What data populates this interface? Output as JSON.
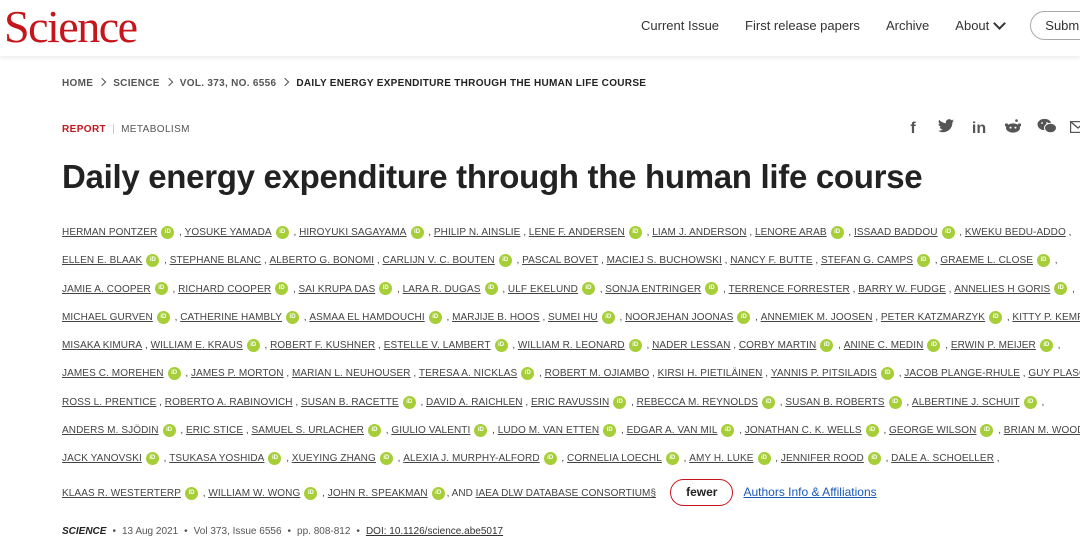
{
  "header": {
    "logo": "Science",
    "nav": [
      "Current Issue",
      "First release papers",
      "Archive",
      "About",
      "Subm"
    ]
  },
  "breadcrumb": [
    "HOME",
    "SCIENCE",
    "VOL. 373, NO. 6556",
    "DAILY ENERGY EXPENDITURE THROUGH THE HUMAN LIFE COURSE"
  ],
  "article": {
    "type": "REPORT",
    "category": "METABOLISM",
    "title": "Daily energy expenditure through the human life course",
    "orcid_label": "iD",
    "fewer_label": "fewer",
    "affiliations_label": "Authors Info & Affiliations",
    "and_text": ", AND"
  },
  "share_icons": [
    "facebook-icon",
    "twitter-icon",
    "linkedin-icon",
    "reddit-icon",
    "wechat-icon",
    "email-icon"
  ],
  "authors": [
    [
      [
        "HERMAN PONTZER",
        1
      ],
      [
        "YOSUKE YAMADA",
        1
      ],
      [
        "HIROYUKI SAGAYAMA",
        1
      ],
      [
        "PHILIP N. AINSLIE",
        0
      ],
      [
        "LENE F. ANDERSEN",
        1
      ],
      [
        "LIAM J. ANDERSON",
        0
      ],
      [
        "LENORE ARAB",
        1
      ],
      [
        "ISSAAD BADDOU",
        1
      ],
      [
        "KWEKU BEDU-ADDO",
        0
      ]
    ],
    [
      [
        "ELLEN E. BLAAK",
        1
      ],
      [
        "STEPHANE BLANC",
        0
      ],
      [
        "ALBERTO G. BONOMI",
        0
      ],
      [
        "CARLIJN V. C. BOUTEN",
        1
      ],
      [
        "PASCAL BOVET",
        0
      ],
      [
        "MACIEJ S. BUCHOWSKI",
        0
      ],
      [
        "NANCY F. BUTTE",
        0
      ],
      [
        "STEFAN G. CAMPS",
        1
      ],
      [
        "GRAEME L. CLOSE",
        1
      ]
    ],
    [
      [
        "JAMIE A. COOPER",
        1
      ],
      [
        "RICHARD COOPER",
        1
      ],
      [
        "SAI KRUPA DAS",
        1
      ],
      [
        "LARA R. DUGAS",
        1
      ],
      [
        "ULF EKELUND",
        1
      ],
      [
        "SONJA ENTRINGER",
        1
      ],
      [
        "TERRENCE FORRESTER",
        0
      ],
      [
        "BARRY W. FUDGE",
        0
      ],
      [
        "ANNELIES H GORIS",
        1
      ]
    ],
    [
      [
        "MICHAEL GURVEN",
        1
      ],
      [
        "CATHERINE HAMBLY",
        1
      ],
      [
        "ASMAA EL HAMDOUCHI",
        1
      ],
      [
        "MARJIJE B. HOOS",
        0
      ],
      [
        "SUMEI HU",
        1
      ],
      [
        "NOORJEHAN JOONAS",
        1
      ],
      [
        "ANNEMIEK M. JOOSEN",
        0
      ],
      [
        "PETER KATZMARZYK",
        1
      ],
      [
        "KITTY P. KEMPEN",
        0
      ]
    ],
    [
      [
        "MISAKA KIMURA",
        0
      ],
      [
        "WILLIAM E. KRAUS",
        1
      ],
      [
        "ROBERT F. KUSHNER",
        0
      ],
      [
        "ESTELLE V. LAMBERT",
        1
      ],
      [
        "WILLIAM R. LEONARD",
        1
      ],
      [
        "NADER LESSAN",
        0
      ],
      [
        "CORBY MARTIN",
        1
      ],
      [
        "ANINE C. MEDIN",
        1
      ],
      [
        "ERWIN P. MEIJER",
        1
      ]
    ],
    [
      [
        "JAMES C. MOREHEN",
        1
      ],
      [
        "JAMES P. MORTON",
        0
      ],
      [
        "MARIAN L. NEUHOUSER",
        0
      ],
      [
        "TERESA A. NICKLAS",
        1
      ],
      [
        "ROBERT M. OJIAMBO",
        0
      ],
      [
        "KIRSI H. PIETILÄINEN",
        0
      ],
      [
        "YANNIS P. PITSILADIS",
        1
      ],
      [
        "JACOB PLANGE-RHULE",
        0
      ],
      [
        "GUY PLASQUI",
        1
      ]
    ],
    [
      [
        "ROSS L. PRENTICE",
        0
      ],
      [
        "ROBERTO A. RABINOVICH",
        0
      ],
      [
        "SUSAN B. RACETTE",
        1
      ],
      [
        "DAVID A. RAICHLEN",
        0
      ],
      [
        "ERIC RAVUSSIN",
        1
      ],
      [
        "REBECCA M. REYNOLDS",
        1
      ],
      [
        "SUSAN B. ROBERTS",
        1
      ],
      [
        "ALBERTINE J. SCHUIT",
        1
      ]
    ],
    [
      [
        "ANDERS M. SJÖDIN",
        1
      ],
      [
        "ERIC STICE",
        0
      ],
      [
        "SAMUEL S. URLACHER",
        1
      ],
      [
        "GIULIO VALENTI",
        1
      ],
      [
        "LUDO M. VAN ETTEN",
        1
      ],
      [
        "EDGAR A. VAN MIL",
        1
      ],
      [
        "JONATHAN C. K. WELLS",
        1
      ],
      [
        "GEORGE WILSON",
        1
      ],
      [
        "BRIAN M. WOOD",
        1
      ]
    ],
    [
      [
        "JACK YANOVSKI",
        1
      ],
      [
        "TSUKASA YOSHIDA",
        1
      ],
      [
        "XUEYING ZHANG",
        1
      ],
      [
        "ALEXIA J. MURPHY-ALFORD",
        1
      ],
      [
        "CORNELIA LOECHL",
        1
      ],
      [
        "AMY H. LUKE",
        1
      ],
      [
        "JENNIFER ROOD",
        1
      ],
      [
        "DALE A. SCHOELLER",
        0
      ]
    ],
    [
      [
        "KLAAS R. WESTERTERP",
        1
      ],
      [
        "WILLIAM W. WONG",
        1
      ],
      [
        "JOHN R. SPEAKMAN",
        1
      ]
    ]
  ],
  "consortium": "IAEA DLW DATABASE CONSORTIUM§",
  "citation": {
    "journal": "SCIENCE",
    "date": "13 Aug 2021",
    "volume": "Vol 373, Issue 6556",
    "pages": "pp. 808-812",
    "doi": "DOI: 10.1126/science.abe5017"
  }
}
